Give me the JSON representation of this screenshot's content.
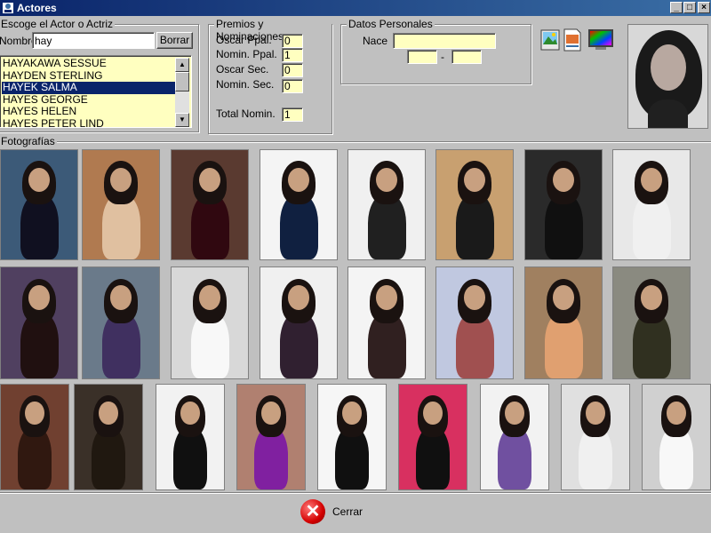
{
  "window": {
    "title": "Actores",
    "controls": [
      "_",
      "□",
      "×"
    ]
  },
  "search": {
    "group_label": "Escoge el Actor o Actriz",
    "name_label": "Nombre",
    "name_value": "hay",
    "clear_button": "Borrar",
    "list": [
      "HAYAKAWA SESSUE",
      "HAYDEN STERLING",
      "HAYEK SALMA",
      "HAYES GEORGE",
      "HAYES HELEN",
      "HAYES PETER LIND"
    ],
    "selected_index": 2
  },
  "awards": {
    "group_label": "Premios y Nominaciones",
    "oscar_ppal_label": "Oscar Ppal.",
    "oscar_ppal_value": "0",
    "nomin_ppal_label": "Nomin. Ppal.",
    "nomin_ppal_value": "1",
    "oscar_sec_label": "Oscar Sec.",
    "oscar_sec_value": "0",
    "nomin_sec_label": "Nomin. Sec.",
    "nomin_sec_value": "0",
    "total_label": "Total Nomin.",
    "total_value": "1"
  },
  "personal": {
    "group_label": "Datos Personales",
    "born_label": "Nace",
    "born_value": "",
    "date_separator": "-"
  },
  "toolbar": {
    "icons": [
      "landscape-image-icon",
      "document-image-icon",
      "color-monitor-icon"
    ]
  },
  "photos": {
    "group_label": "Fotografías"
  },
  "footer": {
    "close_label": "Cerrar"
  },
  "colors": {
    "titlebar": "#0a246a",
    "field_yellow": "#ffffc0",
    "selection": "#0a246a",
    "close_red": "#d40000"
  }
}
